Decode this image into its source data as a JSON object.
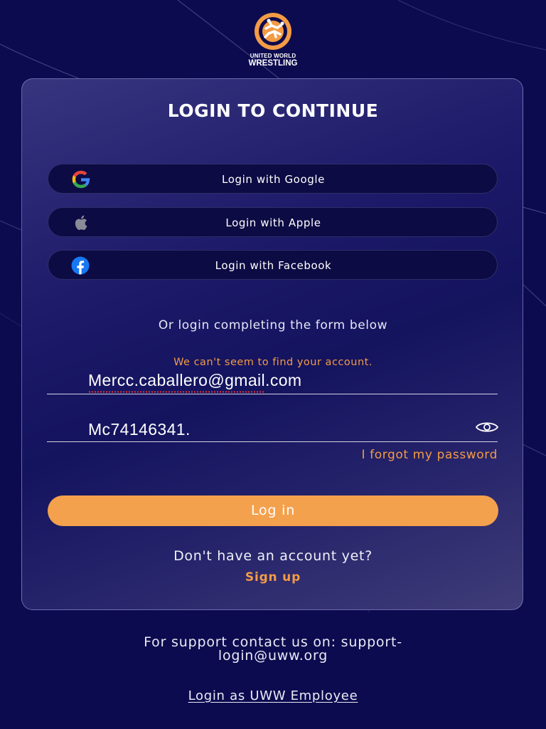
{
  "brand": {
    "line1": "UNITED WORLD",
    "line2": "WRESTLING",
    "logo_color": "#f39b45"
  },
  "card": {
    "title": "LOGIN TO CONTINUE"
  },
  "social": [
    {
      "icon": "google-icon",
      "label": "Login with Google"
    },
    {
      "icon": "apple-icon",
      "label": "Login with Apple"
    },
    {
      "icon": "facebook-icon",
      "label": "Login with Facebook"
    }
  ],
  "form": {
    "divider_text": "Or login completing the form below",
    "error": "We can't seem to find your account.",
    "email_value": "Mercc.caballero@gmail.com",
    "password_value": "Mc74146341.",
    "password_toggle_icon": "eye-icon",
    "forgot_label": "I forgot my password",
    "login_label": "Log in",
    "no_account_text": "Don't have an account yet?",
    "signup_label": "Sign up"
  },
  "footer": {
    "support_line1": "For support contact us on: support-",
    "support_line2": "login@uww.org",
    "employee_link": "Login as UWW Employee"
  },
  "colors": {
    "background": "#0d0b4f",
    "accent": "#f39b45",
    "button": "#f4a14d",
    "error": "#f39b45"
  }
}
